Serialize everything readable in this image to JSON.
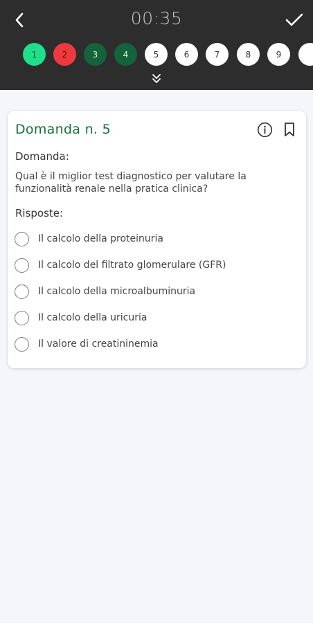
{
  "header": {
    "timer": "00:35",
    "questions": [
      {
        "number": "1",
        "status": "answered-correct"
      },
      {
        "number": "2",
        "status": "answered-wrong"
      },
      {
        "number": "3",
        "status": "answered"
      },
      {
        "number": "4",
        "status": "answered"
      },
      {
        "number": "5",
        "status": "current"
      },
      {
        "number": "6",
        "status": "unanswered"
      },
      {
        "number": "7",
        "status": "unanswered"
      },
      {
        "number": "8",
        "status": "unanswered"
      },
      {
        "number": "9",
        "status": "unanswered"
      }
    ],
    "icons": {
      "back": "chevron-left-icon",
      "confirm": "checkmark-icon",
      "expand": "double-chevron-down-icon"
    }
  },
  "question": {
    "title": "Domanda n. 5",
    "question_label": "Domanda:",
    "text": "Qual è il miglior test diagnostico per valutare la funzionalità renale nella pratica clinica?",
    "answers_label": "Risposte:",
    "answers": [
      "Il calcolo della proteinuria",
      "Il calcolo del filtrato glomerulare (GFR)",
      "Il calcolo della microalbuminuria",
      "Il calcolo della uricuria",
      "Il valore di creatininemia"
    ],
    "icons": {
      "info": "info-icon",
      "bookmark": "bookmark-icon"
    }
  },
  "colors": {
    "header_bg": "#2d2d2d",
    "title_green": "#14703c",
    "dot_light_green": "#1ee08a",
    "dot_red": "#ee3a3f",
    "dot_dark_green": "#14633a"
  }
}
